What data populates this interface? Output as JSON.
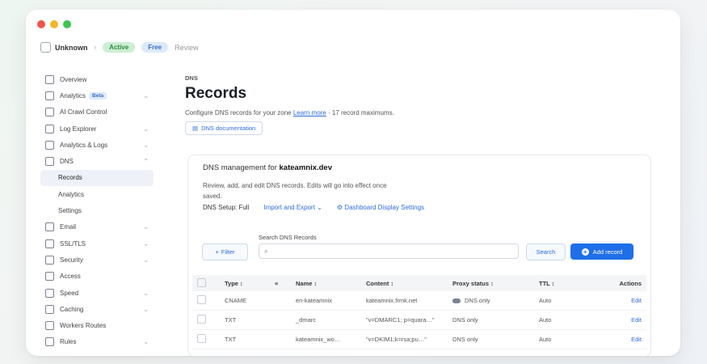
{
  "topbar": {
    "account": "Unknown",
    "badge_green": "Active",
    "badge_blue": "Free",
    "muted": "Review"
  },
  "sidebar": {
    "items": [
      {
        "label": "Overview",
        "tag": "",
        "arrow": false
      },
      {
        "label": "Analytics",
        "tag": "Beta",
        "arrow": true
      },
      {
        "label": "AI Crawl Control",
        "tag": "",
        "arrow": false
      },
      {
        "label": "Log Explorer",
        "tag": "",
        "arrow": true
      },
      {
        "label": "Analytics & Logs",
        "tag": "",
        "arrow": true
      },
      {
        "label": "DNS",
        "tag": "",
        "arrow": true
      }
    ],
    "dns_sub": [
      {
        "label": "Records",
        "active": true
      },
      {
        "label": "Analytics",
        "active": false
      },
      {
        "label": "Settings",
        "active": false
      }
    ],
    "items2": [
      {
        "label": "Email",
        "arrow": true
      },
      {
        "label": "SSL/TLS",
        "arrow": true
      },
      {
        "label": "Security",
        "arrow": true
      },
      {
        "label": "Access",
        "arrow": false
      },
      {
        "label": "Speed",
        "arrow": true
      },
      {
        "label": "Caching",
        "arrow": true
      },
      {
        "label": "Workers Routes",
        "arrow": false
      },
      {
        "label": "Rules",
        "arrow": true
      }
    ]
  },
  "main": {
    "breadcrumb": "DNS",
    "title": "Records",
    "description_pre": "Configure DNS records for your zone ",
    "description_link": "Learn more",
    "description_post": " · 17 record maximums.",
    "doc_button": "DNS documentation",
    "card": {
      "title_pre": "DNS management for ",
      "title_domain": "kateamnix.dev",
      "desc": "Review, add, and edit DNS records. Edits will go into effect once saved.",
      "setup_label": "DNS Setup: Full",
      "import_link": "Import and Export",
      "dashboard_link": "Dashboard Display Settings",
      "search_label": "Search DNS Records",
      "filter_button": "Filter",
      "search_placeholder": "",
      "search_button": "Search",
      "add_button": "Add record"
    },
    "table": {
      "headers": [
        "Type",
        "Name",
        "Content",
        "Proxy status",
        "TTL",
        "Actions"
      ],
      "rows": [
        {
          "type": "CNAME",
          "name": "en-kateamnix",
          "content": "kateamnix.frmk.net",
          "proxy": "DNS only",
          "ttl": "Auto",
          "action": "Edit"
        },
        {
          "type": "TXT",
          "name": "_dmarc",
          "content": "\"v=DMARC1; p=quara…\"",
          "proxy": "DNS only",
          "ttl": "Auto",
          "action": "Edit"
        },
        {
          "type": "TXT",
          "name": "kateamnix_wo…",
          "content": "\"v=DKIM1;k=rsa;pu…\"",
          "proxy": "DNS only",
          "ttl": "Auto",
          "action": "Edit"
        }
      ]
    }
  }
}
